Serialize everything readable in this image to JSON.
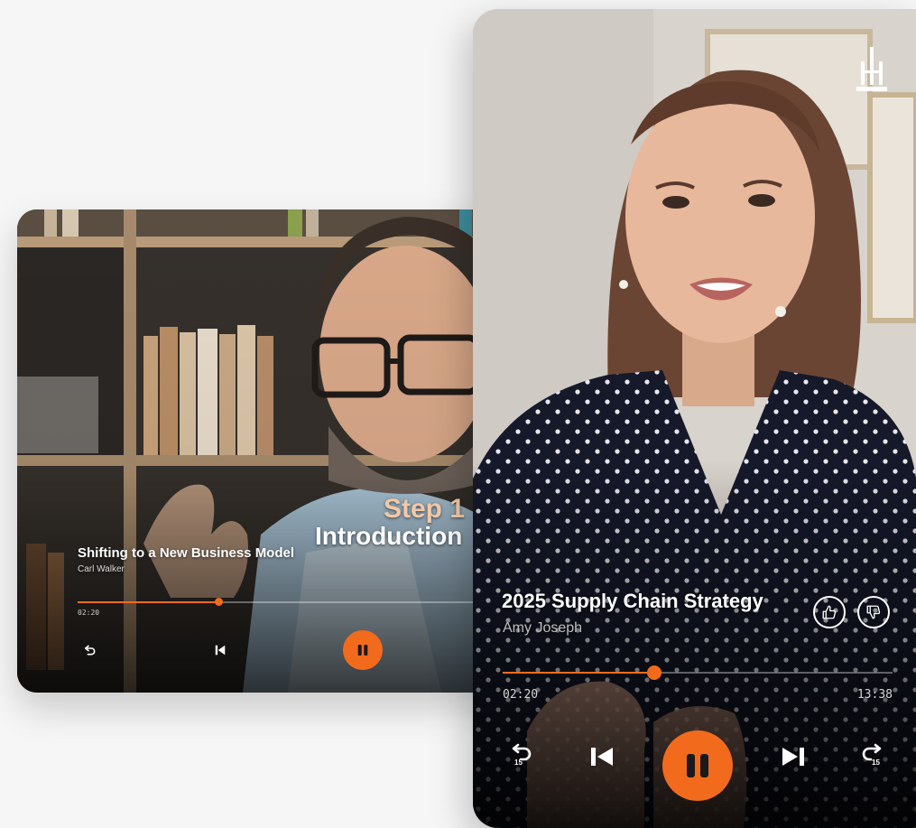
{
  "back_player": {
    "overlay_title": "Step 1",
    "overlay_subtitle": "Introduction",
    "title": "Shifting to a New Business Model",
    "author": "Carl Walker",
    "elapsed": "02:20",
    "progress": 0.33
  },
  "front_player": {
    "title": "2025 Supply Chain Strategy",
    "author": "Amy Joseph",
    "elapsed": "02:20",
    "duration": "13:38",
    "progress": 0.39
  },
  "icons": {
    "logo": "brand-logo-icon",
    "rewind": "rewind-15-icon",
    "forward": "forward-15-icon",
    "previous": "skip-previous-icon",
    "next": "skip-next-icon",
    "pause": "pause-icon",
    "like": "thumbs-up-icon",
    "dislike": "thumbs-down-icon"
  },
  "colors": {
    "accent": "#f26b1d",
    "text": "#ffffff",
    "page_background": "#f6f6f6"
  }
}
